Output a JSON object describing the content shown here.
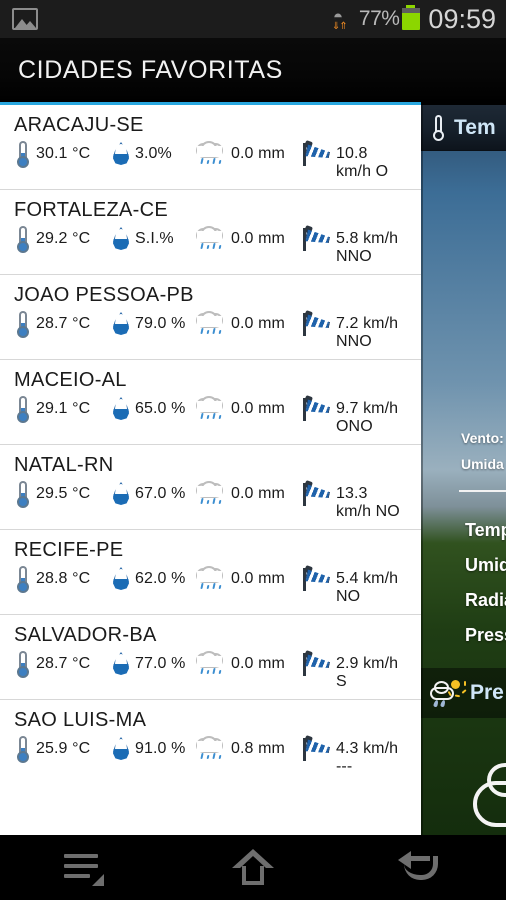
{
  "status_bar": {
    "gallery_icon": "gallery-icon",
    "wifi_icon": "wifi-icon",
    "data_arrows_icon": "data-transfer-arrows-icon",
    "battery_percent": "77%",
    "battery_icon": "battery-icon",
    "clock": "09:59"
  },
  "header": {
    "title": "CIDADES FAVORITAS",
    "accent_color": "#29a7df"
  },
  "cities": [
    {
      "name": "ARACAJU-SE",
      "temperature": "30.1 °C",
      "humidity": "3.0%",
      "rain": "0.0 mm",
      "wind": "10.8 km/h O"
    },
    {
      "name": "FORTALEZA-CE",
      "temperature": "29.2 °C",
      "humidity": "S.I.%",
      "rain": "0.0 mm",
      "wind": "5.8 km/h NNO"
    },
    {
      "name": "JOAO PESSOA-PB",
      "temperature": "28.7 °C",
      "humidity": "79.0 %",
      "rain": "0.0 mm",
      "wind": "7.2 km/h NNO"
    },
    {
      "name": "MACEIO-AL",
      "temperature": "29.1 °C",
      "humidity": "65.0 %",
      "rain": "0.0 mm",
      "wind": "9.7 km/h ONO"
    },
    {
      "name": "NATAL-RN",
      "temperature": "29.5 °C",
      "humidity": "67.0 %",
      "rain": "0.0 mm",
      "wind": "13.3 km/h NO"
    },
    {
      "name": "RECIFE-PE",
      "temperature": "28.8 °C",
      "humidity": "62.0 %",
      "rain": "0.0 mm",
      "wind": "5.4 km/h NO"
    },
    {
      "name": "SALVADOR-BA",
      "temperature": "28.7 °C",
      "humidity": "77.0 %",
      "rain": "0.0 mm",
      "wind": "2.9 km/h S"
    },
    {
      "name": "SAO LUIS-MA",
      "temperature": "25.9 °C",
      "humidity": "91.0 %",
      "rain": "0.8 mm",
      "wind": "4.3 km/h ---"
    }
  ],
  "icons": {
    "temperature": "thermometer-icon",
    "humidity": "water-drop-icon",
    "rain": "rain-cloud-icon",
    "wind": "windsock-icon"
  },
  "detail_panel": {
    "header_title": "Tem",
    "header_icon": "thermometer-icon",
    "sky_labels": [
      "Vento:",
      "Umida"
    ],
    "stats": [
      "Temp",
      "Umid",
      "Radia",
      "Press"
    ],
    "forecast_title": "Pre",
    "forecast_icon": "sun-rain-cloud-icon",
    "cloud_icon": "cloud-outline-icon"
  },
  "nav_bar": {
    "menu_label": "menu-icon",
    "home_label": "home-icon",
    "back_label": "back-icon"
  }
}
